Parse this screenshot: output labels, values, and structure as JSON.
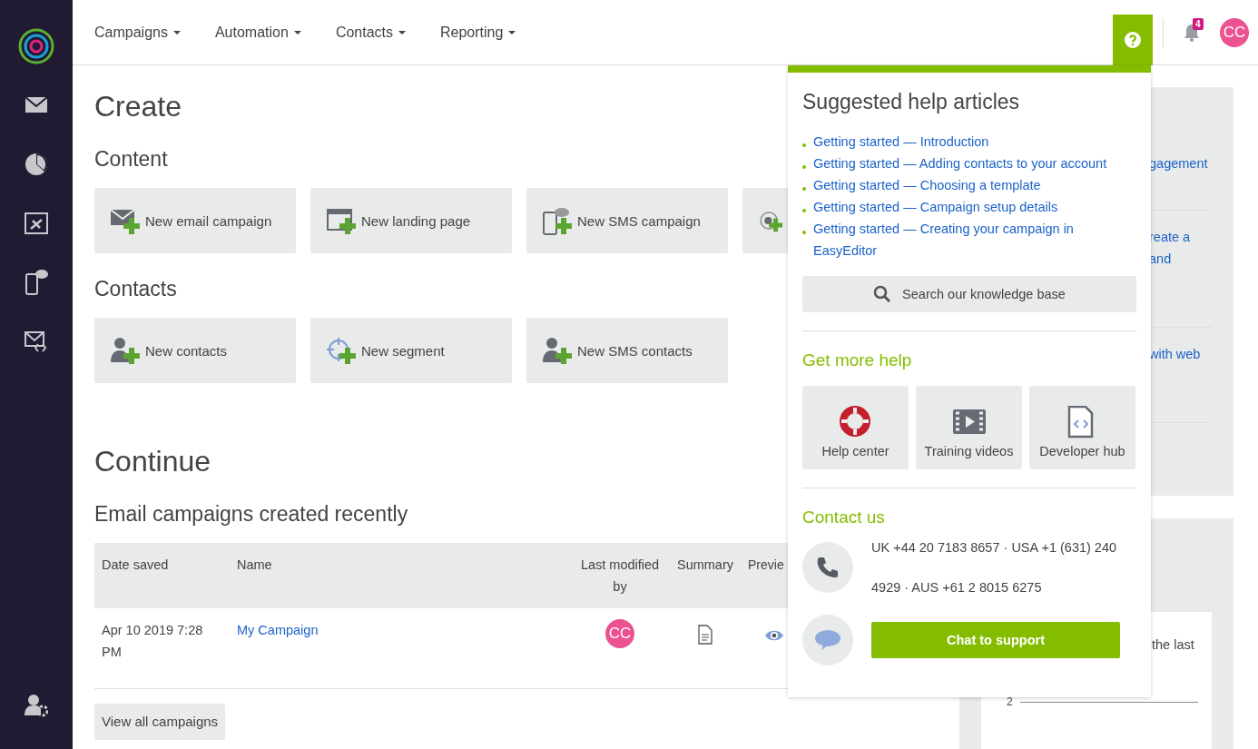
{
  "topbar": {
    "menus": [
      {
        "label": "Campaigns"
      },
      {
        "label": "Automation"
      },
      {
        "label": "Contacts"
      },
      {
        "label": "Reporting"
      }
    ],
    "help": {
      "selected": true
    },
    "notifications": "4",
    "avatar": "CC"
  },
  "create": {
    "title": "Create",
    "sections": [
      {
        "title": "Content",
        "tiles": [
          {
            "kind": "email",
            "label": "New email campaign"
          },
          {
            "kind": "landing",
            "label": "New landing page"
          },
          {
            "kind": "sms",
            "label": "New SMS campaign"
          },
          {
            "kind": "automation"
          }
        ]
      },
      {
        "title": "Contacts",
        "tiles": [
          {
            "kind": "contacts",
            "label": "New contacts"
          },
          {
            "kind": "segment",
            "label": "New segment"
          },
          {
            "kind": "contacts",
            "label": "New SMS contacts"
          }
        ]
      }
    ]
  },
  "continue": {
    "title": "Continue",
    "subtitle": "Email campaigns created recently",
    "table": {
      "columns": [
        "Date saved",
        "Name",
        "Last modified by",
        "Summary",
        "Previe"
      ],
      "rows": [
        {
          "date": "Apr 10 2019 7:28 PM",
          "name": "My Campaign",
          "modified_by": "CC"
        }
      ]
    },
    "button": "View all campaigns"
  },
  "right_column": {
    "panel_texts": [
      [
        "gagement"
      ],
      [
        "reate a",
        "and"
      ],
      [
        "with web"
      ]
    ],
    "card_text": "the last",
    "axis_label": "2"
  },
  "help_popup": {
    "title": "Suggested help articles",
    "articles": [
      "Getting started — Introduction",
      "Getting started — Adding contacts to your account",
      "Getting started — Choosing a template",
      "Getting started — Campaign setup details",
      "Getting started — Creating your campaign in EasyEditor"
    ],
    "search_button": "Search our knowledge base",
    "more_title": "Get more help",
    "resources": [
      {
        "kind": "lifebuoy",
        "label": "Help center"
      },
      {
        "kind": "film",
        "label": "Training videos"
      },
      {
        "kind": "code",
        "label": "Developer hub"
      }
    ],
    "contact_title": "Contact us",
    "phone_text": "UK +44 20 7183 8657 · USA +1 (631) 240 4929 · AUS +61 2 8015 6275",
    "chat_button": "Chat to support"
  }
}
